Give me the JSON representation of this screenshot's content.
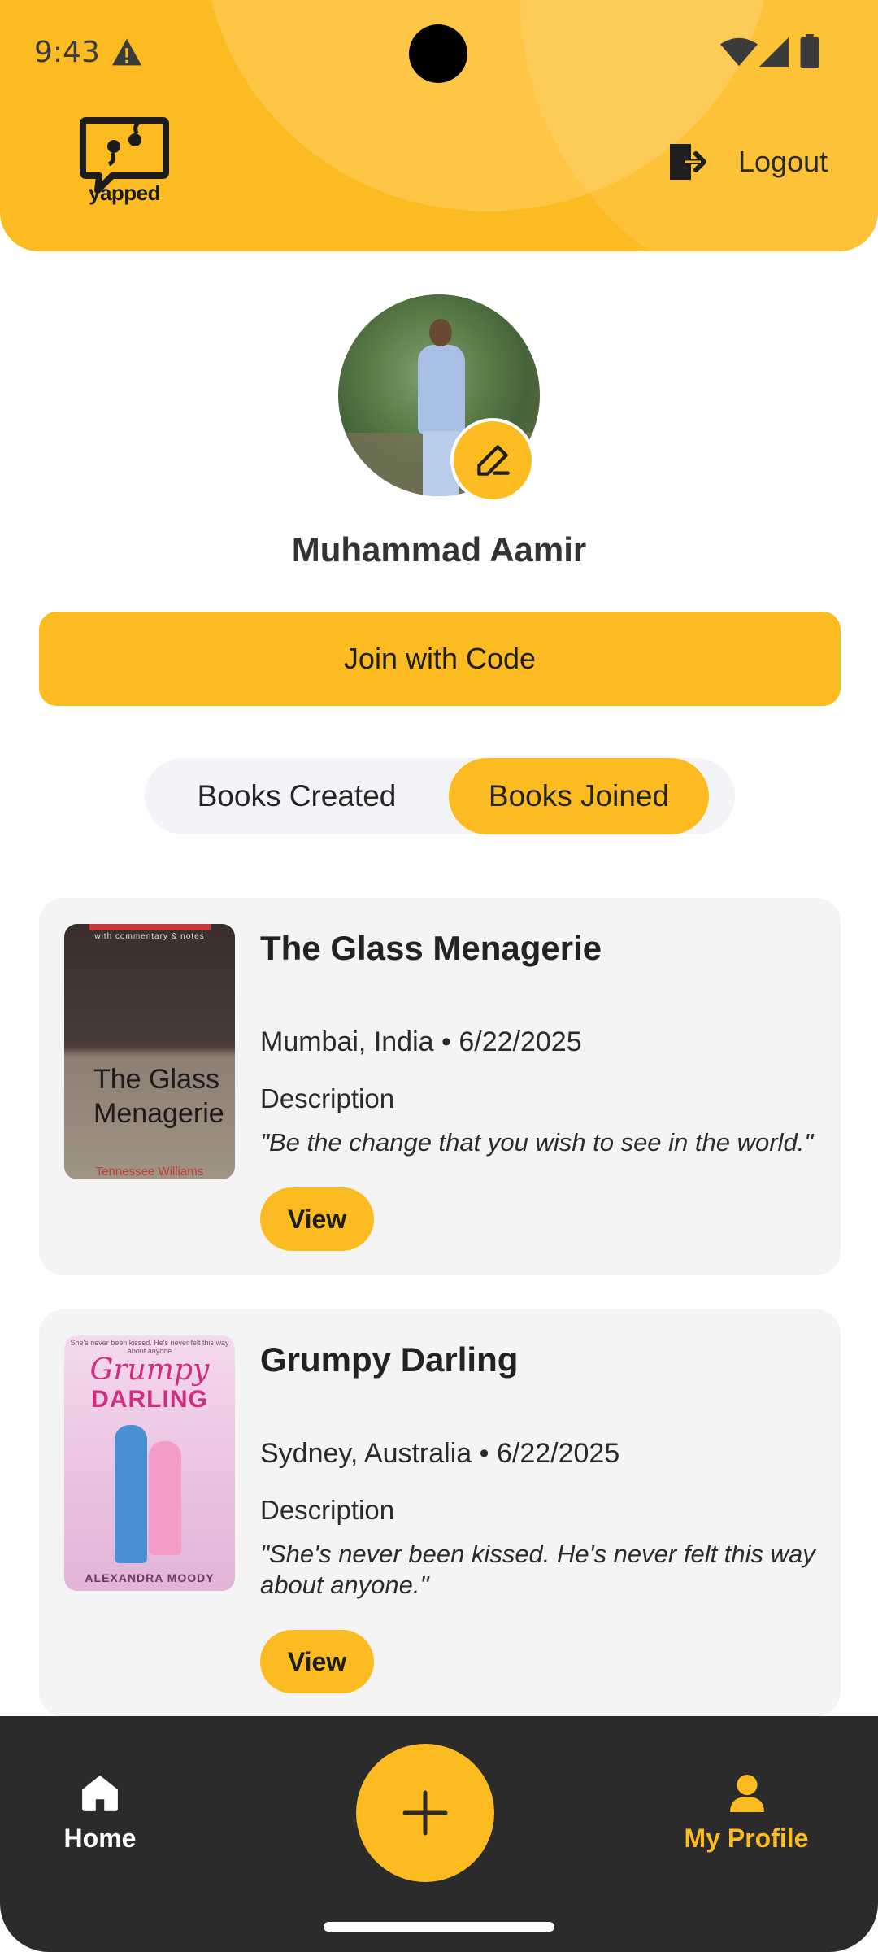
{
  "status_bar": {
    "time": "9:43",
    "icons": [
      "warning-icon",
      "wifi-icon",
      "signal-icon",
      "battery-icon"
    ]
  },
  "header": {
    "logo_text": "yapped",
    "logout_label": "Logout"
  },
  "profile": {
    "name": "Muhammad Aamir"
  },
  "join_button_label": "Join with Code",
  "tabs": [
    {
      "label": "Books Created",
      "selected": false
    },
    {
      "label": "Books Joined",
      "selected": true
    }
  ],
  "books": [
    {
      "title": "The Glass Menagerie",
      "meta": "Mumbai, India • 6/22/2025",
      "description_label": "Description",
      "quote": "\"Be the change that you wish to see in the world.\"",
      "view_label": "View",
      "cover": {
        "subtitle": "with commentary & notes",
        "title": "The Glass Menagerie",
        "author": "Tennessee Williams"
      }
    },
    {
      "title": "Grumpy Darling",
      "meta": "Sydney, Australia • 6/22/2025",
      "description_label": "Description",
      "quote": "\"She's never been kissed. He's never felt this way about anyone.\"",
      "view_label": "View",
      "cover": {
        "tagline": "She's never been kissed. He's never felt this way about anyone",
        "script": "Grumpy",
        "title": "DARLING",
        "author": "ALEXANDRA MOODY"
      }
    }
  ],
  "bottom_nav": {
    "home_label": "Home",
    "profile_label": "My Profile"
  },
  "colors": {
    "accent": "#FDBB22",
    "nav_background": "#2b2b2b",
    "card_background": "#f4f4f4"
  }
}
